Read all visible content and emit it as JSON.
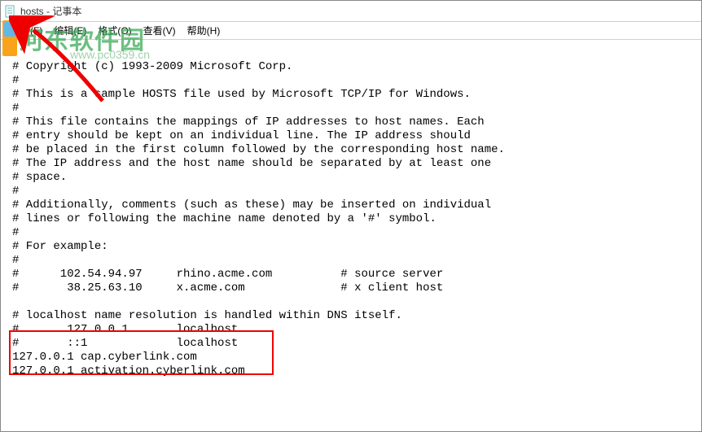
{
  "window": {
    "title": "hosts - 记事本"
  },
  "menu": {
    "file": "文件(F)",
    "edit": "编辑(E)",
    "format": "格式(O)",
    "view": "查看(V)",
    "help": "帮助(H)"
  },
  "watermark": {
    "main": "河东软件园",
    "sub": "www.pc0359.cn"
  },
  "content": {
    "line1": "# Copyright (c) 1993-2009 Microsoft Corp.",
    "line2": "#",
    "line3": "# This is a sample HOSTS file used by Microsoft TCP/IP for Windows.",
    "line4": "#",
    "line5": "# This file contains the mappings of IP addresses to host names. Each",
    "line6": "# entry should be kept on an individual line. The IP address should",
    "line7": "# be placed in the first column followed by the corresponding host name.",
    "line8": "# The IP address and the host name should be separated by at least one",
    "line9": "# space.",
    "line10": "#",
    "line11": "# Additionally, comments (such as these) may be inserted on individual",
    "line12": "# lines or following the machine name denoted by a '#' symbol.",
    "line13": "#",
    "line14": "# For example:",
    "line15": "#",
    "line16": "#      102.54.94.97     rhino.acme.com          # source server",
    "line17": "#       38.25.63.10     x.acme.com              # x client host",
    "line18": "",
    "line19": "# localhost name resolution is handled within DNS itself.",
    "line20": "#       127.0.0.1       localhost",
    "line21": "#       ::1             localhost",
    "line22": "127.0.0.1 cap.cyberlink.com",
    "line23": "127.0.0.1 activation.cyberlink.com"
  }
}
